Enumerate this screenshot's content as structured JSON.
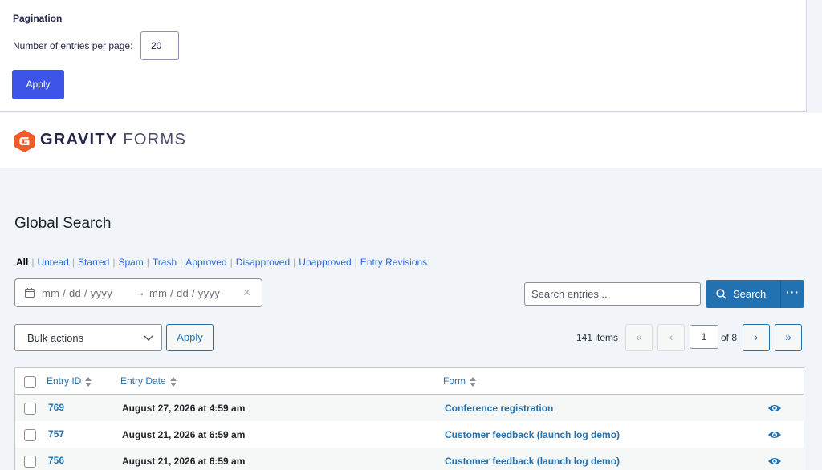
{
  "pagination_settings": {
    "title": "Pagination",
    "label": "Number of entries per page:",
    "value": "20",
    "apply_label": "Apply"
  },
  "brand": {
    "name_bold": "GRAVITY",
    "name_light": "FORMS",
    "accent_color": "#f15a2b"
  },
  "page_title": "Global Search",
  "filters": [
    {
      "label": "All",
      "active": true
    },
    {
      "label": "Unread"
    },
    {
      "label": "Starred"
    },
    {
      "label": "Spam"
    },
    {
      "label": "Trash"
    },
    {
      "label": "Approved"
    },
    {
      "label": "Disapproved"
    },
    {
      "label": "Unapproved"
    },
    {
      "label": "Entry Revisions"
    }
  ],
  "date_range": {
    "start_placeholder": "mm /  dd  /  yyyy",
    "end_placeholder": "mm /  dd  /  yyyy",
    "arrow": "→",
    "clear": "✕",
    "icon": "calendar-icon"
  },
  "search": {
    "placeholder": "Search entries...",
    "button_label": "Search",
    "more_label": "···",
    "button_color": "#2271b1"
  },
  "bulk": {
    "select_label": "Bulk actions",
    "apply_label": "Apply"
  },
  "table_pagination": {
    "items_text": "141 items",
    "first": "«",
    "prev": "‹",
    "current_page": "1",
    "of_text": "of 8",
    "next": "›",
    "last": "»"
  },
  "table": {
    "columns": [
      "Entry ID",
      "Entry Date",
      "Form"
    ],
    "rows": [
      {
        "id": "769",
        "date": "August 27, 2026 at 4:59 am",
        "form": "Conference registration"
      },
      {
        "id": "757",
        "date": "August 21, 2026 at 6:59 am",
        "form": "Customer feedback (launch log demo)"
      },
      {
        "id": "756",
        "date": "August 21, 2026 at 6:59 am",
        "form": "Customer feedback (launch log demo)"
      }
    ]
  }
}
